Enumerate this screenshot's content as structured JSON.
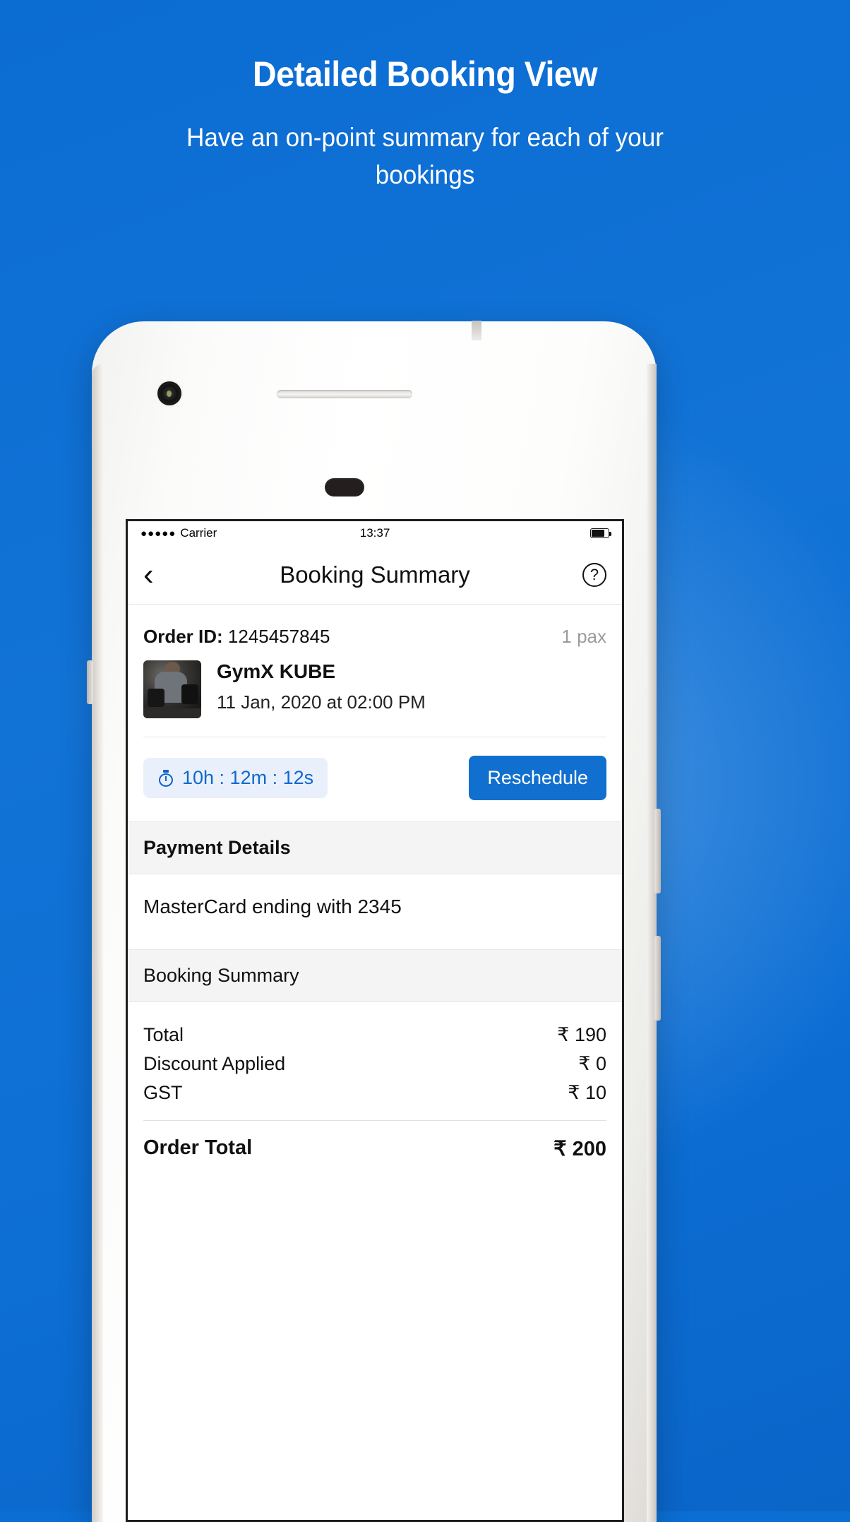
{
  "hero": {
    "title": "Detailed Booking View",
    "subtitle": "Have an on-point summary for each of your bookings"
  },
  "phone": {
    "statusbar": {
      "signal_dots": "●●●●●",
      "carrier": "Carrier",
      "time": "13:37",
      "battery_icon": "battery-icon"
    },
    "navbar": {
      "back_icon": "‹",
      "title": "Booking Summary",
      "help_icon": "?"
    },
    "order": {
      "label": "Order ID:",
      "value": "1245457845",
      "pax": "1 pax"
    },
    "booking": {
      "name": "GymX KUBE",
      "datetime": "11 Jan, 2020 at 02:00 PM",
      "thumbnail_alt": "gym-photo"
    },
    "timer": {
      "icon": "stopwatch-icon",
      "text": "10h : 12m : 12s",
      "reschedule_label": "Reschedule"
    },
    "payment": {
      "heading": "Payment Details",
      "method": "MasterCard ending with 2345"
    },
    "summary": {
      "heading": "Booking Summary",
      "rows": [
        {
          "label": "Total",
          "amount": "₹ 190"
        },
        {
          "label": "Discount Applied",
          "amount": "₹ 0"
        },
        {
          "label": "GST",
          "amount": "₹ 10"
        }
      ],
      "total_label": "Order Total",
      "total_amount": "₹ 200"
    }
  },
  "colors": {
    "background_blue": "#0b6ed3",
    "accent_blue": "#1170cf",
    "timer_chip_bg": "#e9f0fb",
    "timer_text": "#1068cd",
    "section_band": "#f4f4f4",
    "muted_text": "#9b9b9b"
  }
}
